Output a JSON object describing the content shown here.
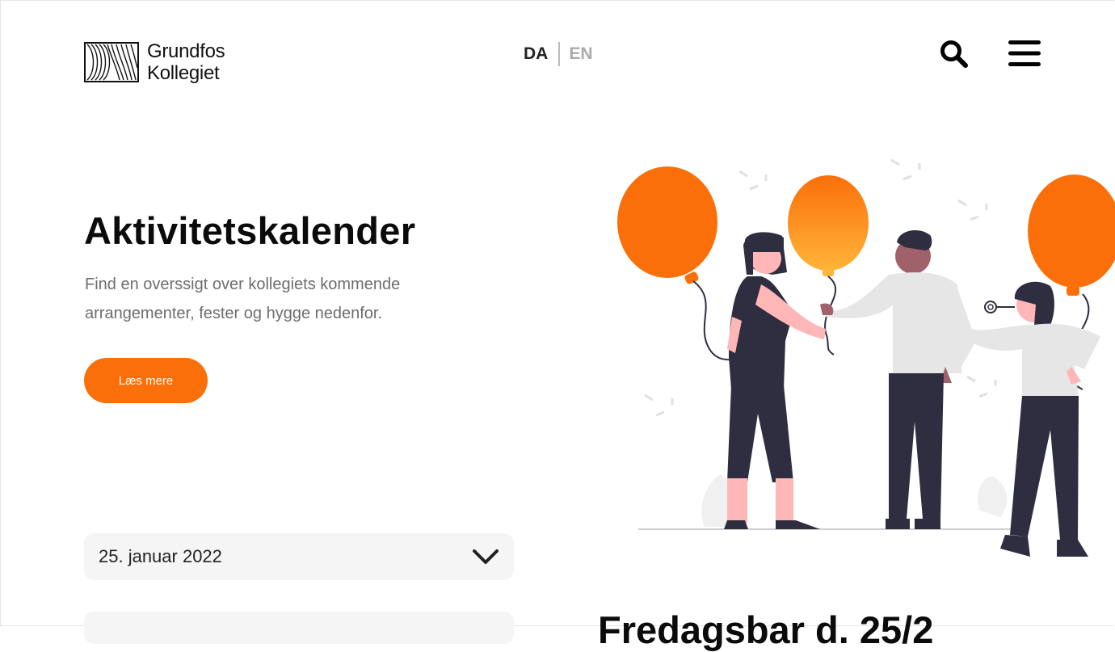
{
  "header": {
    "logo": {
      "line1": "Grundfos",
      "line2": "Kollegiet"
    },
    "lang": {
      "da": "DA",
      "en": "EN",
      "active": "DA"
    },
    "icons": {
      "search": "search-icon",
      "menu": "hamburger-menu-icon"
    }
  },
  "hero": {
    "title": "Aktivitetskalender",
    "description": "Find en overssigt over kollegiets kommende arrangementer, fester og hygge nedenfor.",
    "button_label": "Læs mere"
  },
  "date_select": {
    "value": "25. januar 2022",
    "icon": "chevron-down-icon"
  },
  "event": {
    "heading": "Fredagsbar d. 25/2"
  },
  "colors": {
    "accent": "#fa6f0a",
    "dark": "#2f2e41",
    "light_gray": "#f5f5f5",
    "muted_text": "#6d6d6d"
  }
}
